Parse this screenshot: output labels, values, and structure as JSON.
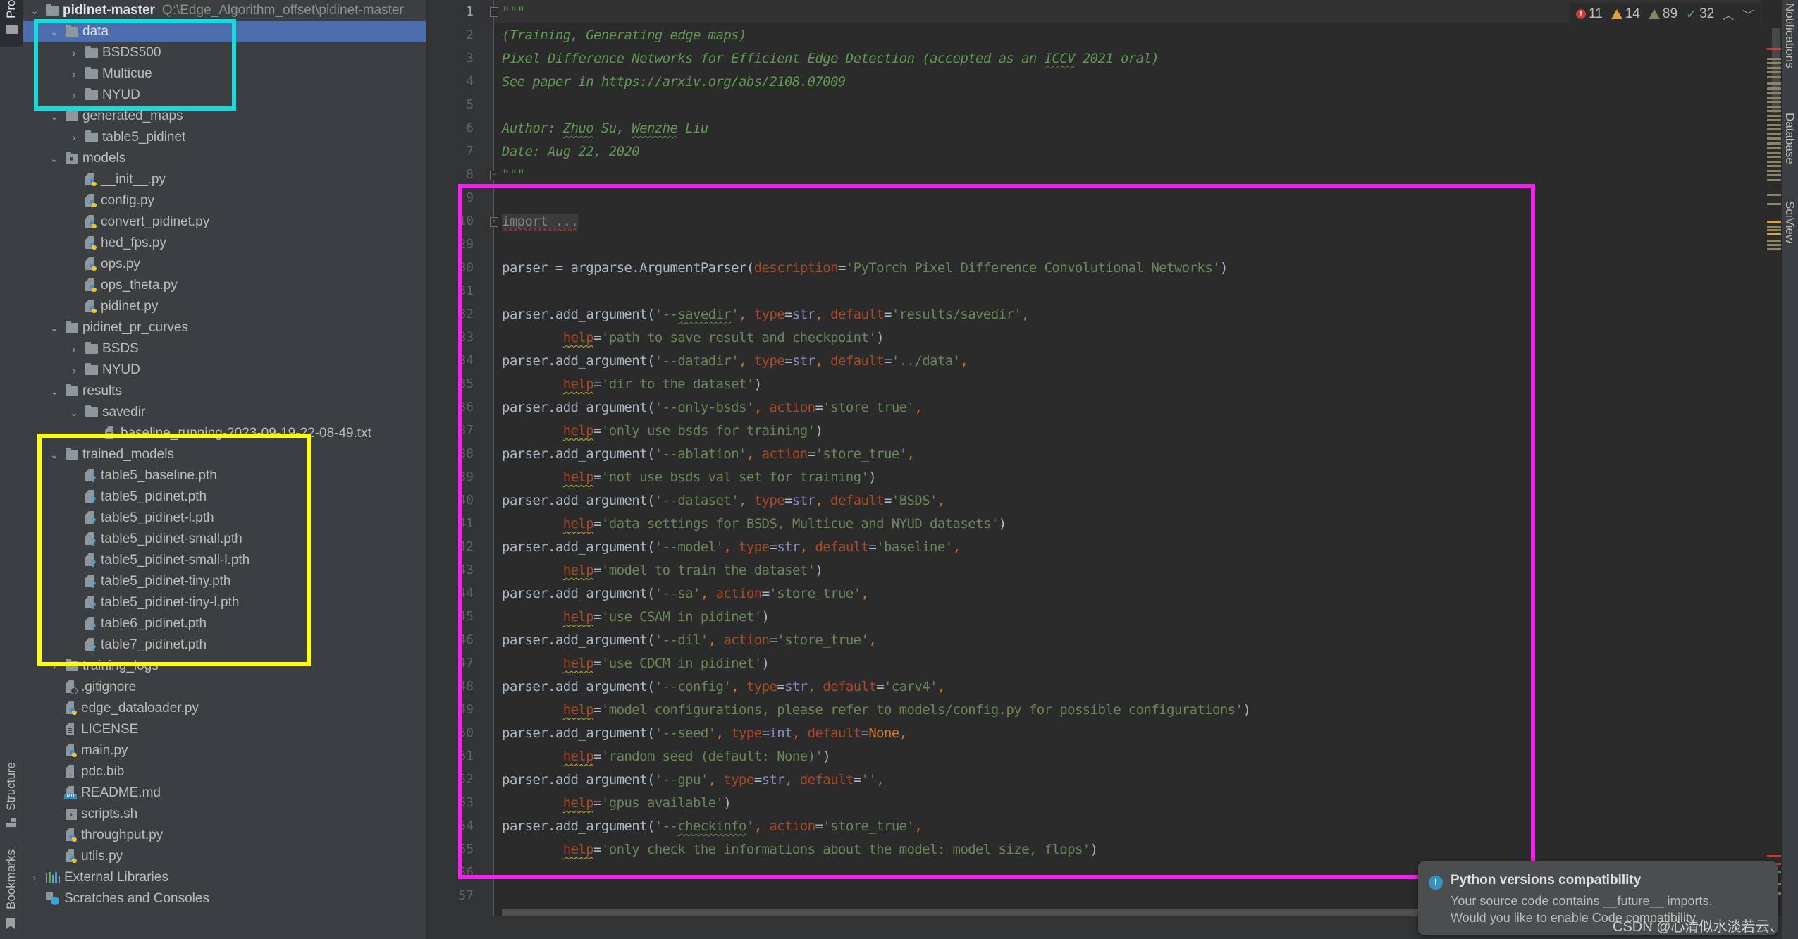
{
  "tool_windows": {
    "left": [
      "Project",
      "Structure",
      "Bookmarks"
    ],
    "right": [
      "Notifications",
      "Database",
      "SciView"
    ]
  },
  "project_tree": {
    "root": {
      "name": "pidinet-master",
      "path": "Q:\\Edge_Algorithm_offset\\pidinet-master"
    },
    "rows": [
      {
        "label": "data",
        "type": "folder",
        "depth": 1,
        "expanded": true,
        "selected": true
      },
      {
        "label": "BSDS500",
        "type": "folder",
        "depth": 2,
        "expanded": false
      },
      {
        "label": "Multicue",
        "type": "folder",
        "depth": 2,
        "expanded": false
      },
      {
        "label": "NYUD",
        "type": "folder",
        "depth": 2,
        "expanded": false
      },
      {
        "label": "generated_maps",
        "type": "folder",
        "depth": 1,
        "expanded": true
      },
      {
        "label": "table5_pidinet",
        "type": "folder",
        "depth": 2,
        "expanded": false
      },
      {
        "label": "models",
        "type": "package",
        "depth": 1,
        "expanded": true
      },
      {
        "label": "__init__.py",
        "type": "python",
        "depth": 2
      },
      {
        "label": "config.py",
        "type": "python",
        "depth": 2
      },
      {
        "label": "convert_pidinet.py",
        "type": "python",
        "depth": 2
      },
      {
        "label": "hed_fps.py",
        "type": "python",
        "depth": 2
      },
      {
        "label": "ops.py",
        "type": "python",
        "depth": 2
      },
      {
        "label": "ops_theta.py",
        "type": "python",
        "depth": 2
      },
      {
        "label": "pidinet.py",
        "type": "python",
        "depth": 2
      },
      {
        "label": "pidinet_pr_curves",
        "type": "folder",
        "depth": 1,
        "expanded": true
      },
      {
        "label": "BSDS",
        "type": "folder",
        "depth": 2,
        "expanded": false
      },
      {
        "label": "NYUD",
        "type": "folder",
        "depth": 2,
        "expanded": false
      },
      {
        "label": "results",
        "type": "folder",
        "depth": 1,
        "expanded": true
      },
      {
        "label": "savedir",
        "type": "folder",
        "depth": 2,
        "expanded": true
      },
      {
        "label": "baseline_running-2023-09-19-22-08-49.txt",
        "type": "text",
        "depth": 3
      },
      {
        "label": "trained_models",
        "type": "folder",
        "depth": 1,
        "expanded": true
      },
      {
        "label": "table5_baseline.pth",
        "type": "unknown",
        "depth": 2
      },
      {
        "label": "table5_pidinet.pth",
        "type": "unknown",
        "depth": 2
      },
      {
        "label": "table5_pidinet-l.pth",
        "type": "unknown",
        "depth": 2
      },
      {
        "label": "table5_pidinet-small.pth",
        "type": "unknown",
        "depth": 2
      },
      {
        "label": "table5_pidinet-small-l.pth",
        "type": "unknown",
        "depth": 2
      },
      {
        "label": "table5_pidinet-tiny.pth",
        "type": "unknown",
        "depth": 2
      },
      {
        "label": "table5_pidinet-tiny-l.pth",
        "type": "unknown",
        "depth": 2
      },
      {
        "label": "table6_pidinet.pth",
        "type": "unknown",
        "depth": 2
      },
      {
        "label": "table7_pidinet.pth",
        "type": "unknown",
        "depth": 2
      },
      {
        "label": "training_logs",
        "type": "folder",
        "depth": 1,
        "expanded": false
      },
      {
        "label": ".gitignore",
        "type": "ignore",
        "depth": 1
      },
      {
        "label": "edge_dataloader.py",
        "type": "python",
        "depth": 1
      },
      {
        "label": "LICENSE",
        "type": "text",
        "depth": 1
      },
      {
        "label": "main.py",
        "type": "python",
        "depth": 1
      },
      {
        "label": "pdc.bib",
        "type": "text",
        "depth": 1
      },
      {
        "label": "README.md",
        "type": "markdown",
        "depth": 1
      },
      {
        "label": "scripts.sh",
        "type": "shell",
        "depth": 1
      },
      {
        "label": "throughput.py",
        "type": "python",
        "depth": 1
      },
      {
        "label": "utils.py",
        "type": "python",
        "depth": 1
      }
    ],
    "external_libraries": "External Libraries",
    "scratches": "Scratches and Consoles"
  },
  "editor": {
    "line_numbers": [
      "1",
      "2",
      "3",
      "4",
      "5",
      "6",
      "7",
      "8",
      "9",
      "10",
      "29",
      "30",
      "31",
      "32",
      "33",
      "34",
      "35",
      "36",
      "37",
      "38",
      "39",
      "40",
      "41",
      "42",
      "43",
      "44",
      "45",
      "46",
      "47",
      "48",
      "49",
      "50",
      "51",
      "52",
      "53",
      "54",
      "55",
      "56",
      "57"
    ],
    "current_line": "1",
    "docstring": {
      "open": "\"\"\"",
      "line2": "(Training, Generating edge maps)",
      "line3a": "Pixel Difference Networks for Efficient Edge Detection (accepted as an ",
      "line3b": "ICCV",
      "line3c": " 2021 oral)",
      "line4a": "See paper in ",
      "line4b": "https://arxiv.org/abs/2108.07009",
      "line6a": "Author: ",
      "line6b": "Zhuo",
      "line6c": " Su, ",
      "line6d": "Wenzhe",
      "line6e": " Liu",
      "line7": "Date: Aug 22, 2020",
      "close": "\"\"\""
    },
    "import_folded": "import ...",
    "parser_line": {
      "lhs": "parser = argparse.ArgumentParser(",
      "kw": "description",
      "value": "'PyTorch Pixel Difference Convolutional Networks'",
      "end": ")"
    },
    "arguments": [
      {
        "flag_pre": "'--",
        "flag": "savedir",
        "flag_post": "'",
        "opts": [
          [
            "type",
            "str",
            "builtin"
          ],
          [
            "default",
            "'results/savedir'",
            "str"
          ]
        ],
        "help": "'path to save result and checkpoint'"
      },
      {
        "flag_pre": "'--",
        "flag": "datadir",
        "flag_post": "'",
        "opts": [
          [
            "type",
            "str",
            "builtin"
          ],
          [
            "default",
            "'../data'",
            "str"
          ]
        ],
        "help": "'dir to the dataset'"
      },
      {
        "flag_pre": "'--",
        "flag": "only-bsds",
        "flag_post": "'",
        "opts": [
          [
            "action",
            "'store_true'",
            "str"
          ]
        ],
        "help": "'only use bsds for training'"
      },
      {
        "flag_pre": "'--",
        "flag": "ablation",
        "flag_post": "'",
        "opts": [
          [
            "action",
            "'store_true'",
            "str"
          ]
        ],
        "help": "'not use bsds val set for training'"
      },
      {
        "flag_pre": "'--",
        "flag": "dataset",
        "flag_post": "'",
        "opts": [
          [
            "type",
            "str",
            "builtin"
          ],
          [
            "default",
            "'BSDS'",
            "str"
          ]
        ],
        "help": "'data settings for BSDS, Multicue and NYUD datasets'"
      },
      {
        "flag_pre": "'--",
        "flag": "model",
        "flag_post": "'",
        "opts": [
          [
            "type",
            "str",
            "builtin"
          ],
          [
            "default",
            "'baseline'",
            "str"
          ]
        ],
        "help": "'model to train the dataset'"
      },
      {
        "flag_pre": "'--",
        "flag": "sa",
        "flag_post": "'",
        "opts": [
          [
            "action",
            "'store_true'",
            "str"
          ]
        ],
        "help": "'use CSAM in pidinet'"
      },
      {
        "flag_pre": "'--",
        "flag": "dil",
        "flag_post": "'",
        "opts": [
          [
            "action",
            "'store_true'",
            "str"
          ]
        ],
        "help": "'use CDCM in pidinet'"
      },
      {
        "flag_pre": "'--",
        "flag": "config",
        "flag_post": "'",
        "opts": [
          [
            "type",
            "str",
            "builtin"
          ],
          [
            "default",
            "'carv4'",
            "str"
          ]
        ],
        "help": "'model configurations, please refer to models/config.py for possible configurations'"
      },
      {
        "flag_pre": "'--",
        "flag": "seed",
        "flag_post": "'",
        "opts": [
          [
            "type",
            "int",
            "builtin"
          ],
          [
            "default",
            "None",
            "none"
          ]
        ],
        "help": "'random seed (default: None)'"
      },
      {
        "flag_pre": "'--",
        "flag": "gpu",
        "flag_post": "'",
        "opts": [
          [
            "type",
            "str",
            "builtin"
          ],
          [
            "default",
            "''",
            "str"
          ]
        ],
        "help": "'gpus available'"
      },
      {
        "flag_pre": "'--",
        "flag": "checkinfo",
        "flag_post": "'",
        "opts": [
          [
            "action",
            "'store_true'",
            "str"
          ]
        ],
        "help": "'only check the informations about the model: model size, flops'"
      }
    ],
    "call_prefix": "parser.add_argument(",
    "help_kw": "help"
  },
  "inspections": {
    "errors": "11",
    "warnings": "14",
    "weak_warnings": "89",
    "typos": "32"
  },
  "notification": {
    "title": "Python versions compatibility",
    "body1": "Your source code contains __future__ imports.",
    "body2": "Would you like to enable Code compatibility"
  },
  "watermark": "CSDN @心清似水淡若云、",
  "colors": {
    "highlight_cyan": "#17dadd",
    "highlight_yellow": "#ffff00",
    "highlight_magenta": "#f51ff1",
    "selection": "#4b6eaf"
  }
}
